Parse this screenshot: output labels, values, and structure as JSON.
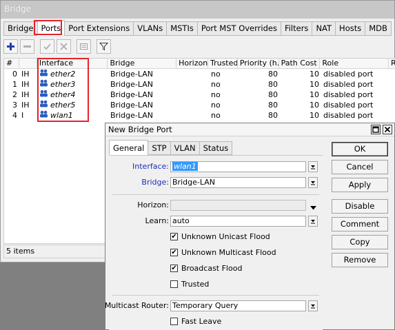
{
  "window_title": "Bridge",
  "tabs": [
    "Bridge",
    "Ports",
    "Port Extensions",
    "VLANs",
    "MSTIs",
    "Port MST Overrides",
    "Filters",
    "NAT",
    "Hosts",
    "MDB"
  ],
  "active_tab": "Ports",
  "toolbar": [
    "add-icon",
    "remove-icon",
    "enable-icon",
    "disable-icon",
    "comment-icon",
    "filter-icon"
  ],
  "table": {
    "headers": [
      "#",
      "",
      "Interface",
      "Bridge",
      "Horizon",
      "Trusted",
      "Priority (h...",
      "Path Cost",
      "Role",
      "R"
    ],
    "rows": [
      {
        "num": "0",
        "flags": "IH",
        "iface": "ether2",
        "bridge": "Bridge-LAN",
        "horizon": "",
        "trusted": "no",
        "priority": "80",
        "cost": "10",
        "role": "disabled port"
      },
      {
        "num": "1",
        "flags": "IH",
        "iface": "ether3",
        "bridge": "Bridge-LAN",
        "horizon": "",
        "trusted": "no",
        "priority": "80",
        "cost": "10",
        "role": "disabled port"
      },
      {
        "num": "2",
        "flags": "IH",
        "iface": "ether4",
        "bridge": "Bridge-LAN",
        "horizon": "",
        "trusted": "no",
        "priority": "80",
        "cost": "10",
        "role": "disabled port"
      },
      {
        "num": "3",
        "flags": "IH",
        "iface": "ether5",
        "bridge": "Bridge-LAN",
        "horizon": "",
        "trusted": "no",
        "priority": "80",
        "cost": "10",
        "role": "disabled port"
      },
      {
        "num": "4",
        "flags": "I",
        "iface": "wlan1",
        "bridge": "Bridge-LAN",
        "horizon": "",
        "trusted": "no",
        "priority": "80",
        "cost": "10",
        "role": "disabled port"
      }
    ]
  },
  "status": "5 items",
  "dialog": {
    "title": "New Bridge Port",
    "tabs": [
      "General",
      "STP",
      "VLAN",
      "Status"
    ],
    "active_tab": "General",
    "interface_label": "Interface:",
    "interface_value": "wlan1",
    "bridge_label": "Bridge:",
    "bridge_value": "Bridge-LAN",
    "horizon_label": "Horizon:",
    "horizon_value": "",
    "learn_label": "Learn:",
    "learn_value": "auto",
    "checks": [
      {
        "label": "Unknown Unicast Flood",
        "checked": true
      },
      {
        "label": "Unknown Multicast Flood",
        "checked": true
      },
      {
        "label": "Broadcast Flood",
        "checked": true
      },
      {
        "label": "Trusted",
        "checked": false
      }
    ],
    "multicast_label": "Multicast Router:",
    "multicast_value": "Temporary Query",
    "fast_leave_label": "Fast Leave",
    "fast_leave_checked": false,
    "buttons": [
      "OK",
      "Cancel",
      "Apply",
      "Disable",
      "Comment",
      "Copy",
      "Remove"
    ]
  },
  "colors": {
    "highlight": "#e3232a",
    "label_blue": "#1a2fb8",
    "selection": "#3399ff"
  }
}
